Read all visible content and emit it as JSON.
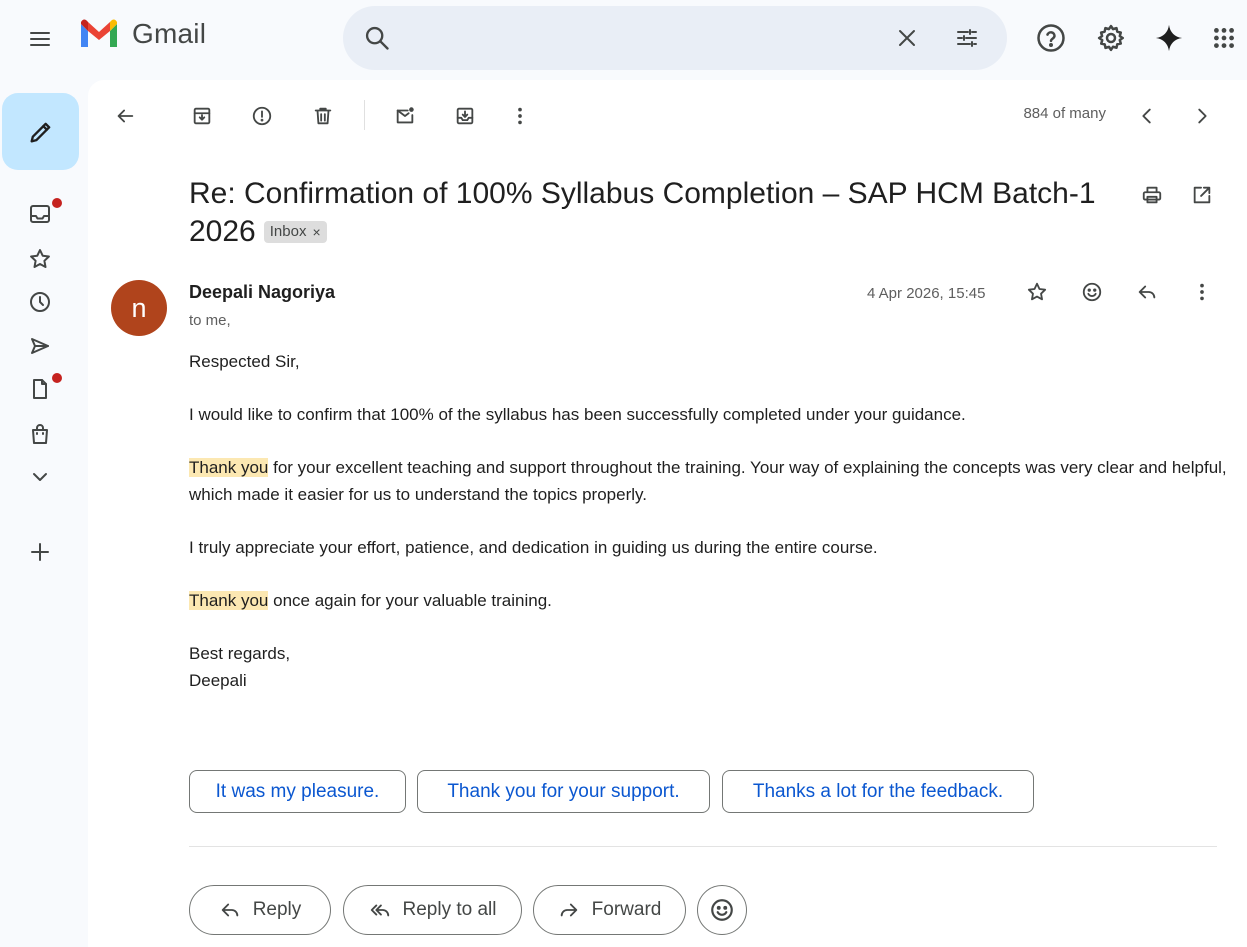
{
  "app": {
    "name": "Gmail"
  },
  "search": {
    "placeholder": "",
    "value": ""
  },
  "toolbar": {
    "counter": "884 of many"
  },
  "email": {
    "subject": "Re: Confirmation of 100% Syllabus Completion – SAP HCM Batch-1 2026",
    "label_chip": "Inbox",
    "label_chip_close": "×",
    "sender_initial": "n",
    "sender_name": "Deepali Nagoriya",
    "recipient": "to me,",
    "date": "4 Apr 2026, 15:45",
    "body": {
      "greeting": "Respected Sir,",
      "p1": "I would like to confirm that 100% of the syllabus has been successfully completed under your guidance.",
      "p2_highlight": "Thank you",
      "p2_rest": " for your excellent teaching and support throughout the training. Your way of explaining the concepts was very clear and helpful, which made it easier for us to understand the topics properly.",
      "p3": "I truly appreciate your effort, patience, and dedication in guiding us during the entire course.",
      "p4_highlight": "Thank you",
      "p4_rest": " once again for your valuable training.",
      "closing": "Best regards,",
      "signature": "Deepali"
    }
  },
  "smart_replies": [
    "It was my pleasure.",
    "Thank you for your support.",
    "Thanks a lot for the feedback."
  ],
  "actions": {
    "reply": "Reply",
    "reply_all": "Reply to all",
    "forward": "Forward"
  },
  "colors": {
    "compose_bg": "#c2e7ff",
    "avatar_bg": "#b0441c",
    "highlight": "#fce8b2",
    "link_blue": "#0b57d0",
    "notification_dot": "#c5221f"
  }
}
